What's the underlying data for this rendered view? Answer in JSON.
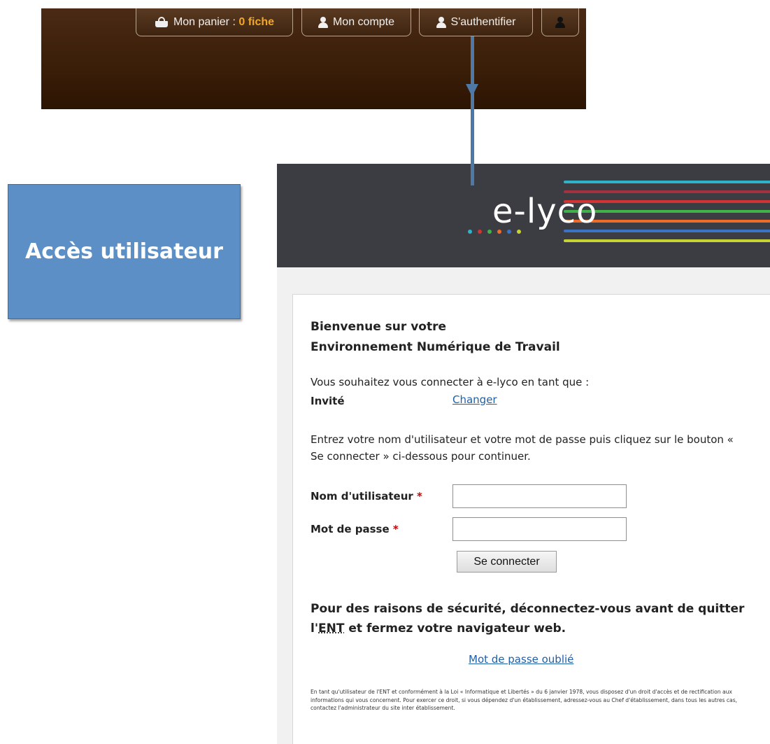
{
  "toolbar": {
    "basket_label": "Mon panier : ",
    "basket_count": "0 fiche",
    "account_label": "Mon compte",
    "login_label": "S'authentifier",
    "highlight_color": "#f2a72a",
    "background_color": "#3a1e08"
  },
  "callout": {
    "label": "Accès utilisateur",
    "color": "#5b8fc6"
  },
  "connector_color": "#4e79a7",
  "elyco": {
    "logo": "e-lyco",
    "header_color": "#3c3c43",
    "stripe_colors": [
      "#2fb3c8",
      "#a3313f",
      "#d43333",
      "#3fb24a",
      "#ef6b2a",
      "#3a72c4",
      "#c7d334"
    ],
    "dot_colors": [
      "#2fb3c8",
      "#d43333",
      "#3fb24a",
      "#ef6b2a",
      "#3a72c4",
      "#c7d334"
    ]
  },
  "login": {
    "welcome_line1": "Bienvenue sur votre",
    "welcome_line2": "Environnement Numérique de Travail",
    "intro": "Vous souhaitez vous connecter à e-lyco en tant que :",
    "role": "Invité",
    "change_link": "Changer",
    "instructions": "Entrez votre nom d'utilisateur et votre mot de passe puis cliquez sur le bouton « Se connecter » ci-dessous pour continuer.",
    "username_label": "Nom d'utilisateur",
    "password_label": "Mot de passe",
    "required_mark": "*",
    "username_value": "",
    "password_value": "",
    "submit_label": "Se connecter",
    "security_pre": "Pour des raisons de sécurité, déconnectez-vous avant de quitter l'",
    "security_abbr": "ENT",
    "security_post": " et fermez votre navigateur web.",
    "forgot_link": "Mot de passe oublié",
    "legal_notice": "En tant qu'utilisateur de l'ENT et conformément à la Loi « Informatique et Libertés » du 6 janvier 1978, vous disposez d'un droit d'accès et de rectification aux informations qui vous concernent. Pour exercer ce droit, si vous dépendez d'un établissement, adressez-vous au Chef d'établissement, dans tous les autres cas, contactez l'administrateur du site inter établissement."
  }
}
